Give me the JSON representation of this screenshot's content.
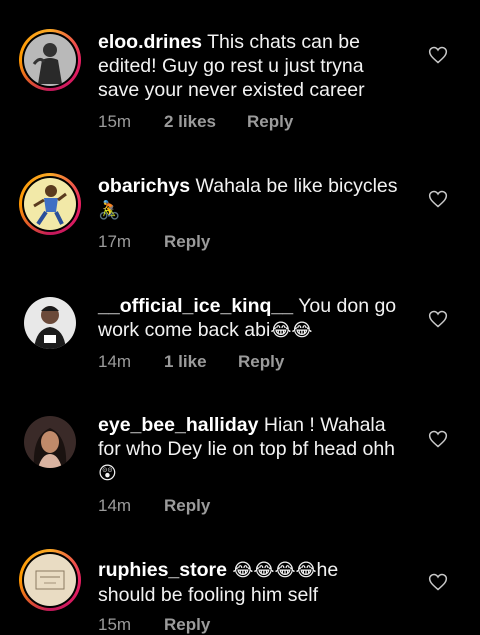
{
  "comments": [
    {
      "username": "eloo.drines",
      "text": "This chats can be edited! Guy go rest u just tryna save your never existed career",
      "time": "15m",
      "likes": "2 likes",
      "reply": "Reply",
      "avatar_icon": "person-silhouette-avatar",
      "story_ring": true
    },
    {
      "username": "obarichys",
      "text": "Wahala be like bicycles",
      "emoji": "🚴",
      "time": "17m",
      "likes": "",
      "reply": "Reply",
      "avatar_icon": "cartoon-avatar",
      "story_ring": true
    },
    {
      "username": "__official_ice_kinq__",
      "text": "You don go work come back abi",
      "emoji": "😂😂",
      "time": "14m",
      "likes": "1 like",
      "reply": "Reply",
      "avatar_icon": "person-avatar",
      "story_ring": false
    },
    {
      "username": "eye_bee_halliday",
      "text": "Hian ! Wahala for who Dey lie on top bf head ohh",
      "emoji": "😲",
      "time": "14m",
      "likes": "",
      "reply": "Reply",
      "avatar_icon": "person-avatar",
      "story_ring": false
    },
    {
      "username": "ruphies_store",
      "text": "he should be fooling him self",
      "emoji": "😂😂😂😂",
      "time": "15m",
      "likes": "",
      "reply": "Reply",
      "avatar_icon": "store-logo-avatar",
      "story_ring": true
    }
  ],
  "colors": {
    "background": "#000000",
    "text": "#f2f2f2",
    "meta": "#9b9b9b"
  }
}
